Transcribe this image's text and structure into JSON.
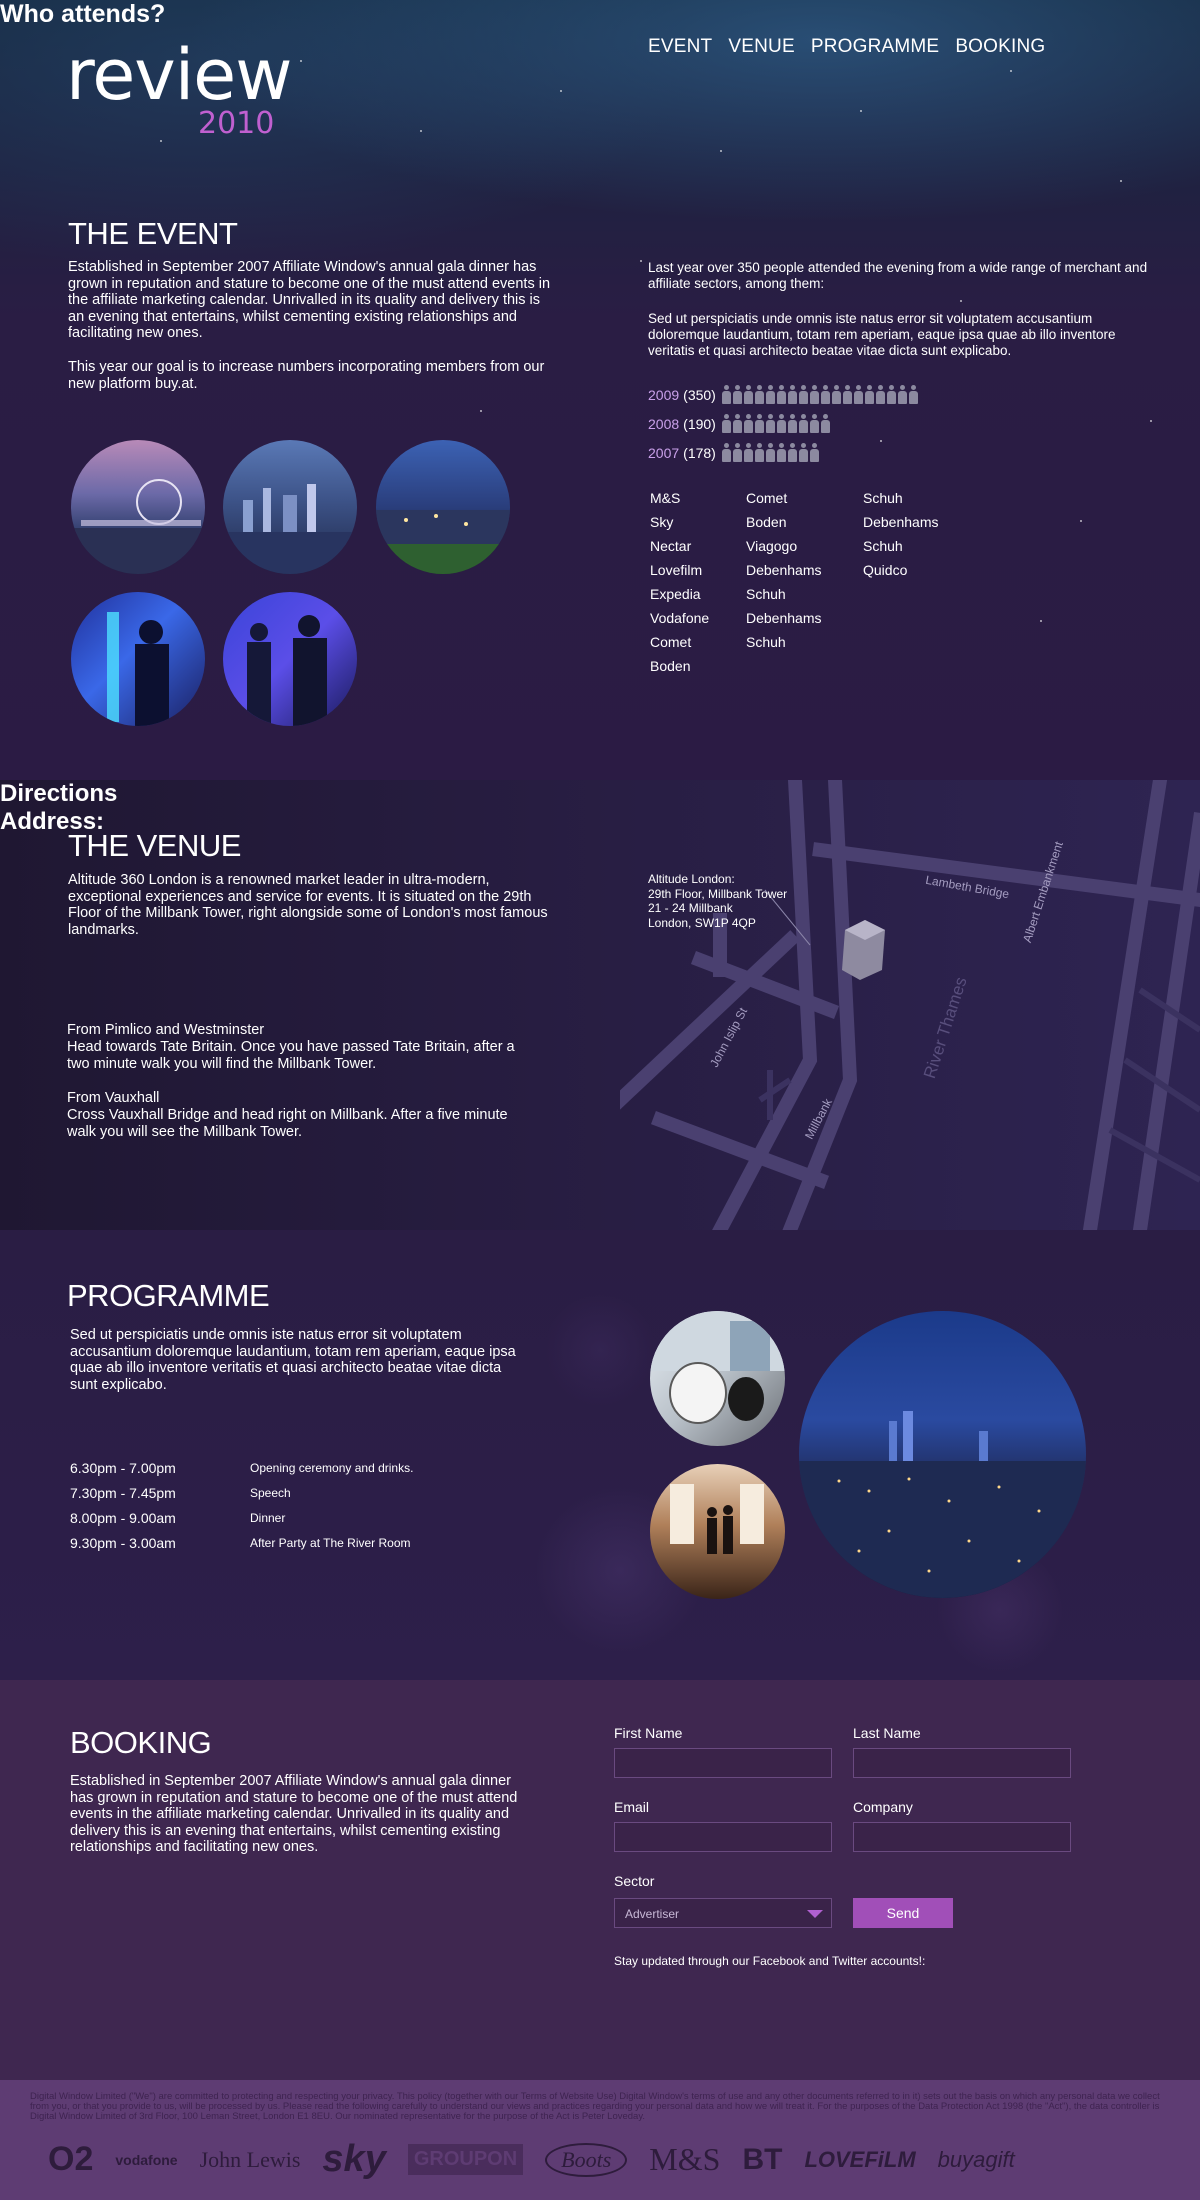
{
  "header": {
    "logo_word": "review",
    "logo_year": "2010",
    "nav": [
      "EVENT",
      "VENUE",
      "PROGRAMME",
      "BOOKING"
    ]
  },
  "event": {
    "title": "THE EVENT",
    "para1": "Established in September 2007 Affiliate Window's annual gala dinner has grown in reputation and stature to become one of the must attend events in the affiliate marketing calendar.  Unrivalled in its quality and delivery this is an evening that entertains, whilst cementing existing relationships and facilitating new ones.",
    "para2": "This year our goal is to increase numbers incorporating members from our new platform buy.at."
  },
  "attends": {
    "title": "Who attends?",
    "para1": "Last year over 350 people attended the evening from a wide range of merchant and affiliate sectors, among them:",
    "para2": "Sed ut perspiciatis unde omnis iste natus error sit voluptatem accusantium doloremque laudantium, totam rem aperiam, eaque ipsa quae ab illo inventore veritatis et quasi architecto beatae vitae dicta sunt explicabo.",
    "years": [
      {
        "year": "2009",
        "count": "(350)",
        "value": 350
      },
      {
        "year": "2008",
        "count": "(190)",
        "value": 190
      },
      {
        "year": "2007",
        "count": "(178)",
        "value": 178
      }
    ],
    "brands": [
      [
        "M&S",
        "Sky",
        "Nectar",
        "Lovefilm",
        "Expedia",
        "Vodafone",
        "Comet",
        "Boden"
      ],
      [
        "Comet",
        "Boden",
        "Viagogo",
        "Debenhams",
        "Schuh",
        "Debenhams",
        "Schuh"
      ],
      [
        "Schuh",
        "Debenhams",
        "Schuh",
        "Quidco"
      ]
    ]
  },
  "venue": {
    "title": "THE VENUE",
    "para": "Altitude 360 London is a renowned market leader in ultra-modern, exceptional experiences and service for events. It is situated on the 29th Floor of the Millbank Tower, right alongside some of London's most famous landmarks.",
    "directions_title": "Directions",
    "dir1_head": "From Pimlico and Westminster",
    "dir1_text": "Head towards Tate Britain. Once you have passed Tate Britain, after a two minute walk you will find the Millbank Tower.",
    "dir2_head": "From Vauxhall",
    "dir2_text": "Cross Vauxhall Bridge and head right on Millbank. After a five minute walk you will see the Millbank Tower.",
    "address_title": "Address:",
    "address_lines": [
      "Altitude London:",
      "29th Floor, Millbank Tower",
      "21 - 24 Millbank",
      "London, SW1P 4QP"
    ],
    "map_labels": {
      "lambeth": "Lambeth Bridge",
      "albert": "Albert Embankment",
      "thames": "River Thames",
      "islip": "John Islip St",
      "millbank": "Millbank"
    }
  },
  "programme": {
    "title": "PROGRAMME",
    "para": "Sed ut perspiciatis unde omnis iste natus error sit voluptatem accusantium doloremque laudantium, totam rem aperiam, eaque ipsa quae ab illo inventore veritatis et quasi architecto beatae vitae dicta sunt explicabo.",
    "schedule": [
      {
        "time": "6.30pm - 7.00pm",
        "desc": "Opening ceremony and drinks."
      },
      {
        "time": "7.30pm - 7.45pm",
        "desc": "Speech"
      },
      {
        "time": "8.00pm - 9.00am",
        "desc": "Dinner"
      },
      {
        "time": "9.30pm - 3.00am",
        "desc": "After Party at The River Room"
      }
    ]
  },
  "booking": {
    "title": "BOOKING",
    "para": "Established in September 2007 Affiliate Window's annual gala dinner has grown in reputation and stature to become one of the must attend events in the affiliate marketing calendar.  Unrivalled in its quality and delivery this is an evening that entertains, whilst cementing existing relationships and facilitating new ones.",
    "first_name": "First Name",
    "last_name": "Last Name",
    "email": "Email",
    "company": "Company",
    "sector": "Sector",
    "sector_value": "Advertiser",
    "send": "Send",
    "stay_updated": "Stay updated  through our Facebook and Twitter accounts!:"
  },
  "footer": {
    "legal": "Digital Window Limited (\"We\") are committed to protecting and respecting your privacy. This policy (together with our Terms of Website Use) Digital Window's terms of use and any other documents referred to in it) sets out the basis on which any personal data we collect from you, or that you provide to us, will be processed by us. Please read the following carefully to understand our views and practices regarding your personal data and how we will treat it. For the purposes of the Data Protection Act 1998 (the \"Act\"), the data controller is Digital Window Limited of 3rd Floor, 100 Leman Street, London E1 8EU.  Our nominated representative for the purpose of the Act is Peter Loveday.",
    "logos": [
      "O2",
      "vodafone",
      "John Lewis",
      "sky",
      "GROUPON",
      "Boots",
      "M&S",
      "BT",
      "LOVEFiLM",
      "buyagift"
    ]
  },
  "colors": {
    "accent": "#c060d0",
    "year": "#c9a0ea",
    "send": "#a14fb8",
    "booking_bg": "#3f2750",
    "footer_bg": "#5e3c73"
  }
}
